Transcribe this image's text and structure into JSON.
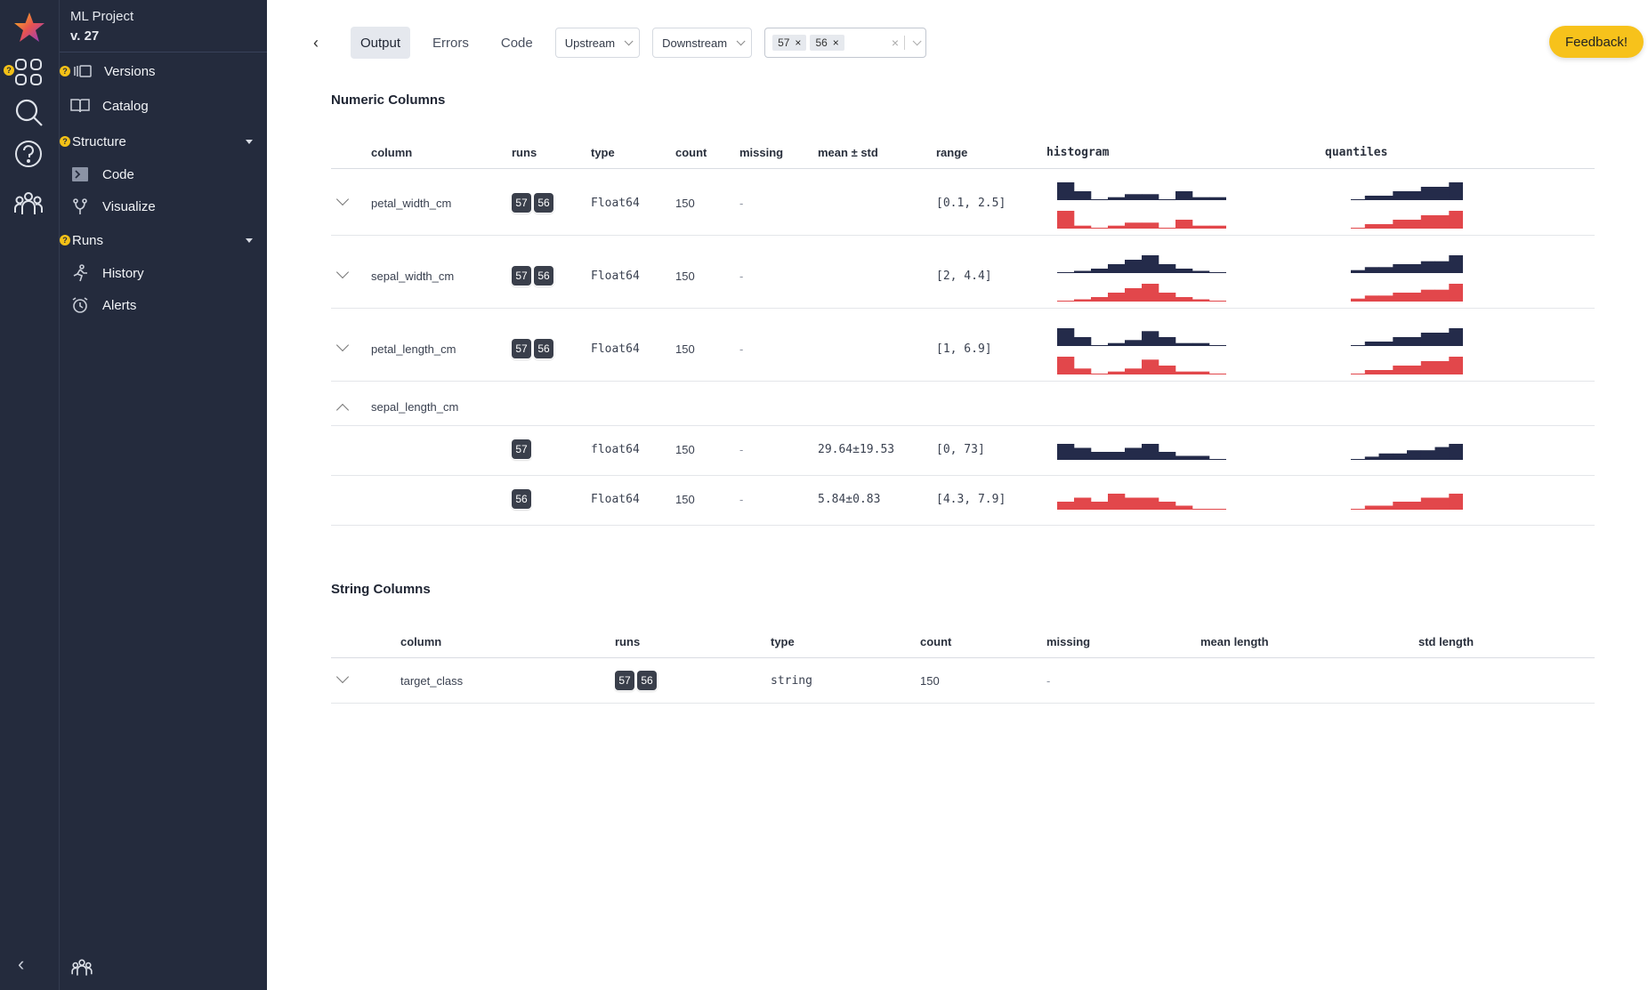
{
  "app": {
    "project_name": "ML Project",
    "version": "v. 27"
  },
  "sidebar": {
    "items": [
      {
        "label": "Versions",
        "icon": "versions-icon",
        "flag": "?"
      },
      {
        "label": "Catalog",
        "icon": "book-icon"
      }
    ],
    "structure": {
      "label": "Structure",
      "flag": "?",
      "children": [
        {
          "label": "Code",
          "icon": "terminal-icon"
        },
        {
          "label": "Visualize",
          "icon": "branch-icon"
        }
      ]
    },
    "runs": {
      "label": "Runs",
      "flag": "?",
      "children": [
        {
          "label": "History",
          "icon": "runner-icon"
        },
        {
          "label": "Alerts",
          "icon": "alarm-icon"
        }
      ]
    }
  },
  "toolbar": {
    "tabs": [
      "Output",
      "Errors",
      "Code"
    ],
    "active_tab": "Output",
    "upstream": "Upstream",
    "downstream": "Downstream",
    "selected_runs": [
      "57",
      "56"
    ],
    "feedback": "Feedback!"
  },
  "colors": {
    "run_57": "#242b4a",
    "run_56": "#e2474b",
    "sidebar_bg": "#242b3d",
    "accent": "#f7c21b"
  },
  "numeric": {
    "title": "Numeric Columns",
    "headers": [
      "column",
      "runs",
      "type",
      "count",
      "missing",
      "mean ± std",
      "range",
      "histogram",
      "quantiles"
    ],
    "rows": [
      {
        "column": "petal_width_cm",
        "runs": [
          "57",
          "56"
        ],
        "type": "Float64",
        "count": "150",
        "missing": "-",
        "mean": "",
        "range": "[0.1, 2.5]",
        "hist_top": [
          6,
          3,
          0,
          1,
          2,
          2,
          0,
          3,
          1,
          1
        ],
        "hist_bot": [
          6,
          1,
          0,
          1,
          2,
          2,
          0,
          3,
          1,
          1
        ],
        "q_top": [
          0,
          1,
          1,
          2,
          2,
          3,
          3,
          4
        ],
        "q_bot": [
          0,
          1,
          1,
          2,
          2,
          3,
          3,
          4
        ]
      },
      {
        "column": "sepal_width_cm",
        "runs": [
          "57",
          "56"
        ],
        "type": "Float64",
        "count": "150",
        "missing": "-",
        "mean": "",
        "range": "[2, 4.4]",
        "hist_top": [
          0,
          1,
          2,
          4,
          6,
          8,
          4,
          2,
          1,
          0
        ],
        "hist_bot": [
          0,
          1,
          2,
          4,
          6,
          8,
          4,
          2,
          1,
          0
        ],
        "q_top": [
          1,
          2,
          2,
          3,
          3,
          4,
          4,
          6
        ],
        "q_bot": [
          1,
          2,
          2,
          3,
          3,
          4,
          4,
          6
        ]
      },
      {
        "column": "petal_length_cm",
        "runs": [
          "57",
          "56"
        ],
        "type": "Float64",
        "count": "150",
        "missing": "-",
        "mean": "",
        "range": "[1, 6.9]",
        "hist_top": [
          6,
          3,
          0,
          1,
          2,
          5,
          3,
          1,
          1,
          0
        ],
        "hist_bot": [
          6,
          2,
          0,
          1,
          2,
          5,
          3,
          1,
          1,
          0
        ],
        "q_top": [
          0,
          1,
          1,
          2,
          2,
          3,
          3,
          4
        ],
        "q_bot": [
          0,
          1,
          1,
          2,
          2,
          3,
          3,
          4
        ]
      }
    ],
    "expanded": {
      "column": "sepal_length_cm",
      "subrows": [
        {
          "run": "57",
          "type": "float64",
          "count": "150",
          "missing": "-",
          "mean": "29.64±19.53",
          "range": "[0, 73]",
          "hist": [
            4,
            3,
            2,
            2,
            3,
            4,
            2,
            1,
            1,
            0
          ],
          "q": [
            0,
            1,
            2,
            2,
            3,
            3,
            4,
            5
          ]
        },
        {
          "run": "56",
          "type": "Float64",
          "count": "150",
          "missing": "-",
          "mean": "5.84±0.83",
          "range": "[4.3, 7.9]",
          "hist": [
            2,
            3,
            2,
            4,
            3,
            3,
            2,
            1,
            0,
            0
          ],
          "q": [
            0,
            1,
            1,
            2,
            2,
            3,
            3,
            4
          ]
        }
      ]
    }
  },
  "string": {
    "title": "String Columns",
    "headers": [
      "column",
      "runs",
      "type",
      "count",
      "missing",
      "mean length",
      "std length"
    ],
    "rows": [
      {
        "column": "target_class",
        "runs": [
          "57",
          "56"
        ],
        "type": "string",
        "count": "150",
        "missing": "-",
        "mean_length": "",
        "std_length": ""
      }
    ]
  }
}
